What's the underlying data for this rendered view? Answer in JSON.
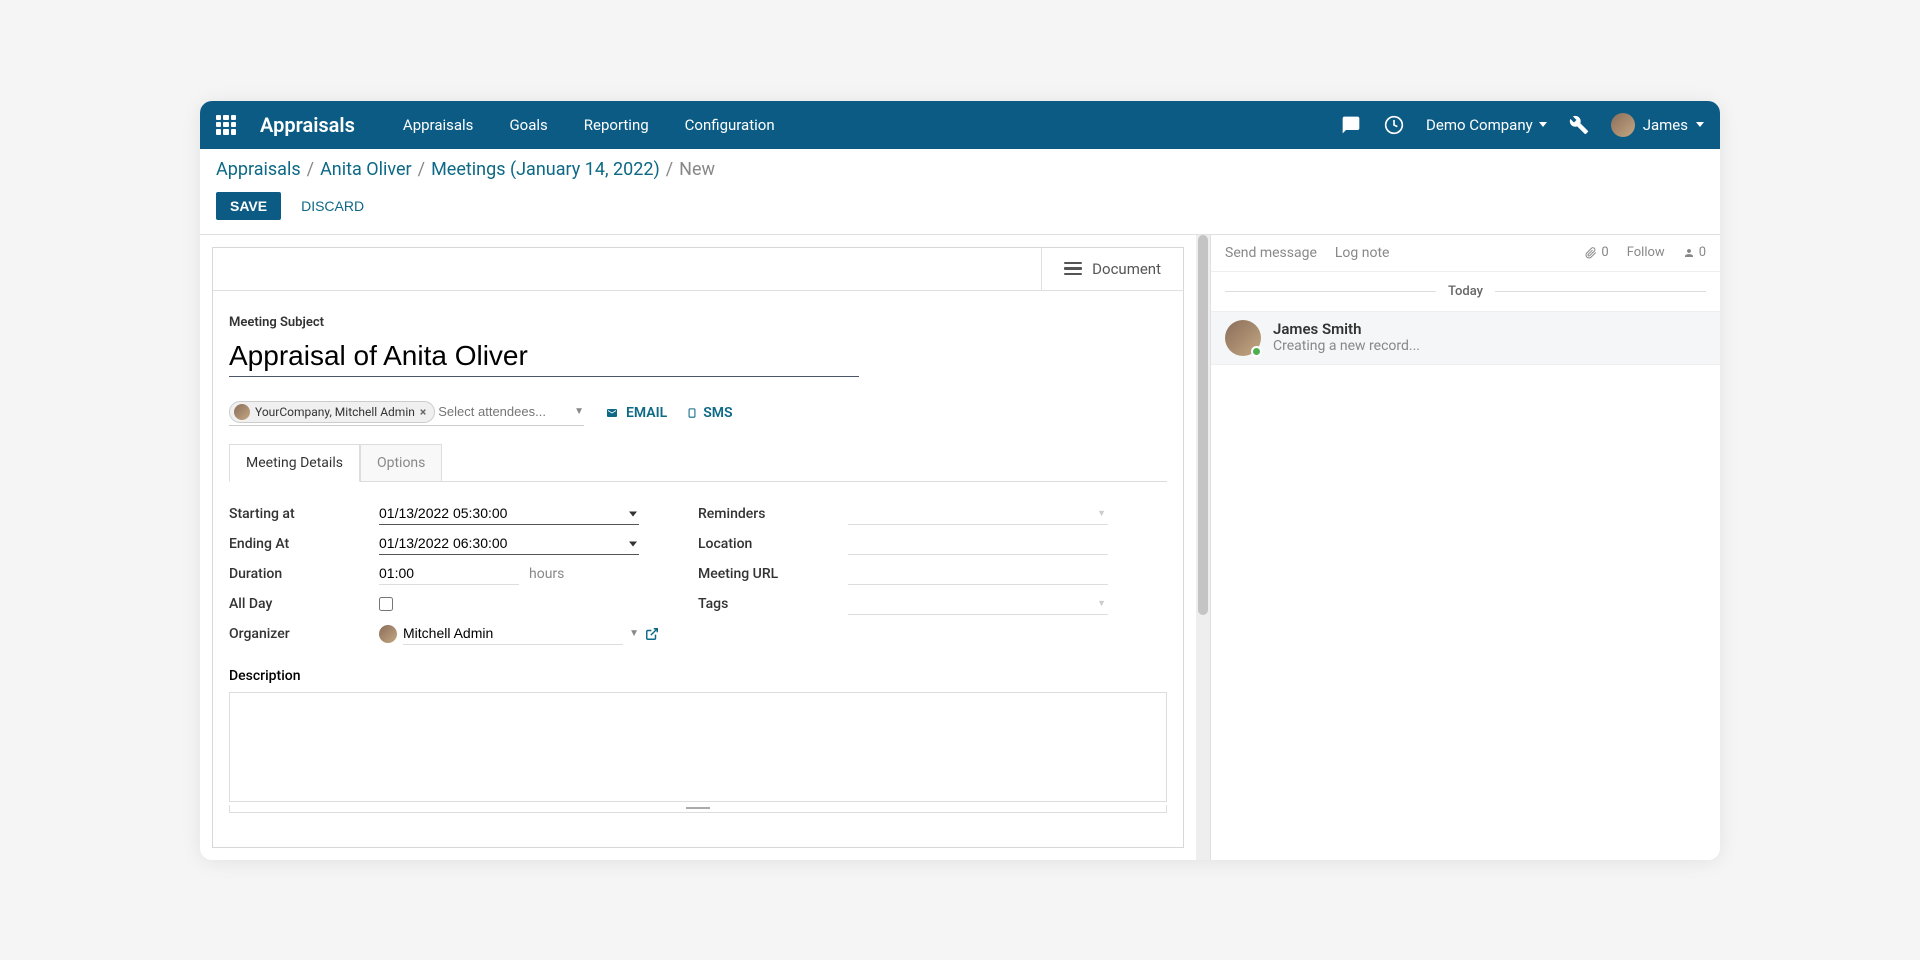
{
  "header": {
    "app_title": "Appraisals",
    "nav": [
      "Appraisals",
      "Goals",
      "Reporting",
      "Configuration"
    ],
    "company": "Demo Company",
    "user": "James"
  },
  "breadcrumb": {
    "items": [
      "Appraisals",
      "Anita Oliver",
      "Meetings (January 14, 2022)"
    ],
    "current": "New"
  },
  "actions": {
    "save": "SAVE",
    "discard": "DISCARD"
  },
  "card": {
    "document_btn": "Document"
  },
  "form": {
    "subject_label": "Meeting Subject",
    "subject_value": "Appraisal of Anita Oliver",
    "attendee_tag": "YourCompany, Mitchell Admin",
    "attendees_placeholder": "Select attendees...",
    "email_label": "EMAIL",
    "sms_label": "SMS",
    "tabs": {
      "details": "Meeting Details",
      "options": "Options"
    },
    "fields": {
      "starting_at": {
        "label": "Starting at",
        "value": "01/13/2022 05:30:00"
      },
      "ending_at": {
        "label": "Ending At",
        "value": "01/13/2022 06:30:00"
      },
      "duration": {
        "label": "Duration",
        "value": "01:00",
        "suffix": "hours"
      },
      "all_day": {
        "label": "All Day"
      },
      "organizer": {
        "label": "Organizer",
        "value": "Mitchell Admin"
      },
      "reminders": {
        "label": "Reminders"
      },
      "location": {
        "label": "Location"
      },
      "meeting_url": {
        "label": "Meeting URL"
      },
      "tags": {
        "label": "Tags"
      },
      "description": {
        "label": "Description"
      }
    }
  },
  "chatter": {
    "send_message": "Send message",
    "log_note": "Log note",
    "attach_count": "0",
    "follow": "Follow",
    "follower_count": "0",
    "today": "Today",
    "message": {
      "author": "James Smith",
      "body": "Creating a new record..."
    }
  }
}
